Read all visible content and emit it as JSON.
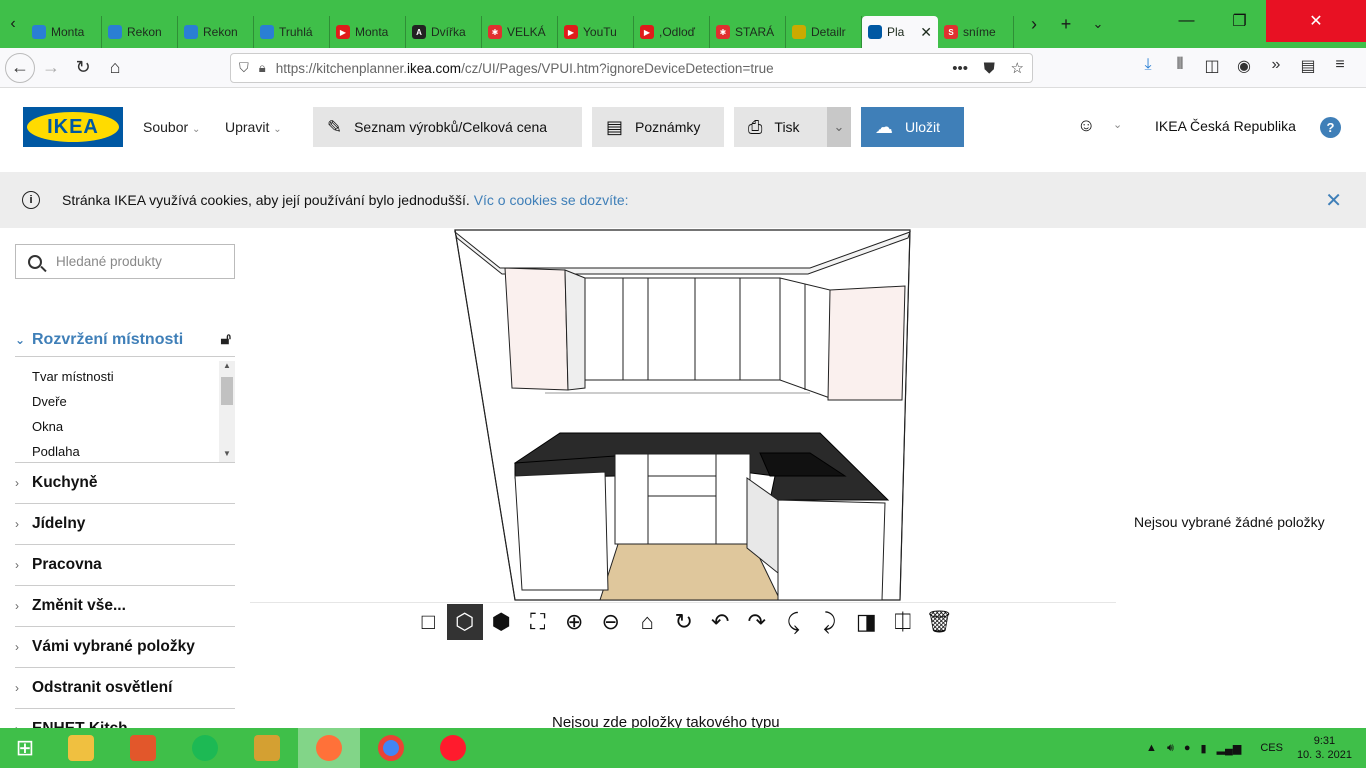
{
  "browser": {
    "tabs": [
      {
        "title": "Monta",
        "fav_color": "#2a7fd4",
        "fav_glyph": ""
      },
      {
        "title": "Rekon",
        "fav_color": "#2a7fd4",
        "fav_glyph": ""
      },
      {
        "title": "Rekon",
        "fav_color": "#2a7fd4",
        "fav_glyph": ""
      },
      {
        "title": "Truhlá",
        "fav_color": "#2a7fd4",
        "fav_glyph": ""
      },
      {
        "title": "Monta",
        "fav_color": "#e01b1b",
        "fav_glyph": "▶"
      },
      {
        "title": "Dvířka",
        "fav_color": "#222222",
        "fav_glyph": "A"
      },
      {
        "title": "VELKÁ",
        "fav_color": "#e03030",
        "fav_glyph": "✱"
      },
      {
        "title": "YouTu",
        "fav_color": "#e01b1b",
        "fav_glyph": "▶"
      },
      {
        "title": ",Odloď",
        "fav_color": "#e01b1b",
        "fav_glyph": "▶"
      },
      {
        "title": "STARÁ",
        "fav_color": "#e03030",
        "fav_glyph": "✱"
      },
      {
        "title": "Detailr",
        "fav_color": "#ccaa00",
        "fav_glyph": ""
      },
      {
        "title": "Pla",
        "fav_color": "#0058a3",
        "fav_glyph": ""
      },
      {
        "title": "sníme",
        "fav_color": "#e03030",
        "fav_glyph": "S"
      }
    ],
    "url_prefix": "https://kitchenplanner.",
    "url_domain": "ikea.com",
    "url_suffix": "/cz/UI/Pages/VPUI.htm?ignoreDeviceDetection=true"
  },
  "header": {
    "logo_text": "IKEA",
    "menu_file": "Soubor",
    "menu_edit": "Upravit",
    "btn_product_list": "Seznam výrobků/Celková cena",
    "btn_notes": "Poznámky",
    "btn_print": "Tisk",
    "btn_save": "Uložit",
    "country": "IKEA Česká Republika",
    "help": "?"
  },
  "cookie": {
    "text": "Stránka IKEA využívá cookies, aby její používání bylo jednodušší.",
    "link": "Víc o cookies se dozvíte:"
  },
  "sidebar": {
    "search_placeholder": "Hledané produkty",
    "section_title": "Rozvržení místnosti",
    "sub_items": [
      "Tvar místnosti",
      "Dveře",
      "Okna",
      "Podlaha"
    ],
    "categories": [
      "Kuchyně",
      "Jídelny",
      "Pracovna",
      "Změnit vše...",
      "Vámi vybrané položky",
      "Odstranit osvětlení",
      "ENHET Kitch"
    ]
  },
  "canvas": {
    "bottom_text": "Nejsou zde položky takového typu"
  },
  "right_panel": {
    "message": "Nejsou vybrané žádné položky"
  },
  "taskbar": {
    "time": "9:31",
    "date": "10. 3. 2021",
    "lang": "CES"
  }
}
